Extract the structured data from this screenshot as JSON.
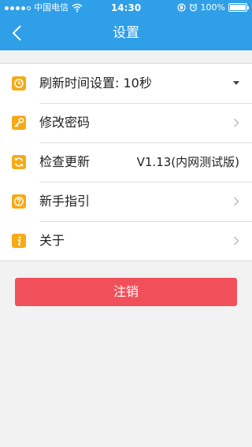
{
  "status_bar": {
    "carrier": "中国电信",
    "time": "14:30",
    "battery": "100%"
  },
  "nav": {
    "title": "设置"
  },
  "menu": {
    "refresh": {
      "label": "刷新时间设置: 10秒",
      "icon": "clock-icon"
    },
    "password": {
      "label": "修改密码",
      "icon": "key-icon"
    },
    "update": {
      "label": "检查更新",
      "value": "V1.13(内网测试版)",
      "icon": "refresh-icon"
    },
    "guide": {
      "label": "新手指引",
      "icon": "question-icon"
    },
    "about": {
      "label": "关于",
      "icon": "info-icon"
    }
  },
  "logout": {
    "label": "注销"
  },
  "colors": {
    "nav_bg": "#2f9fe8",
    "icon_bg": "#f5ab16",
    "logout_bg": "#f1505a"
  }
}
